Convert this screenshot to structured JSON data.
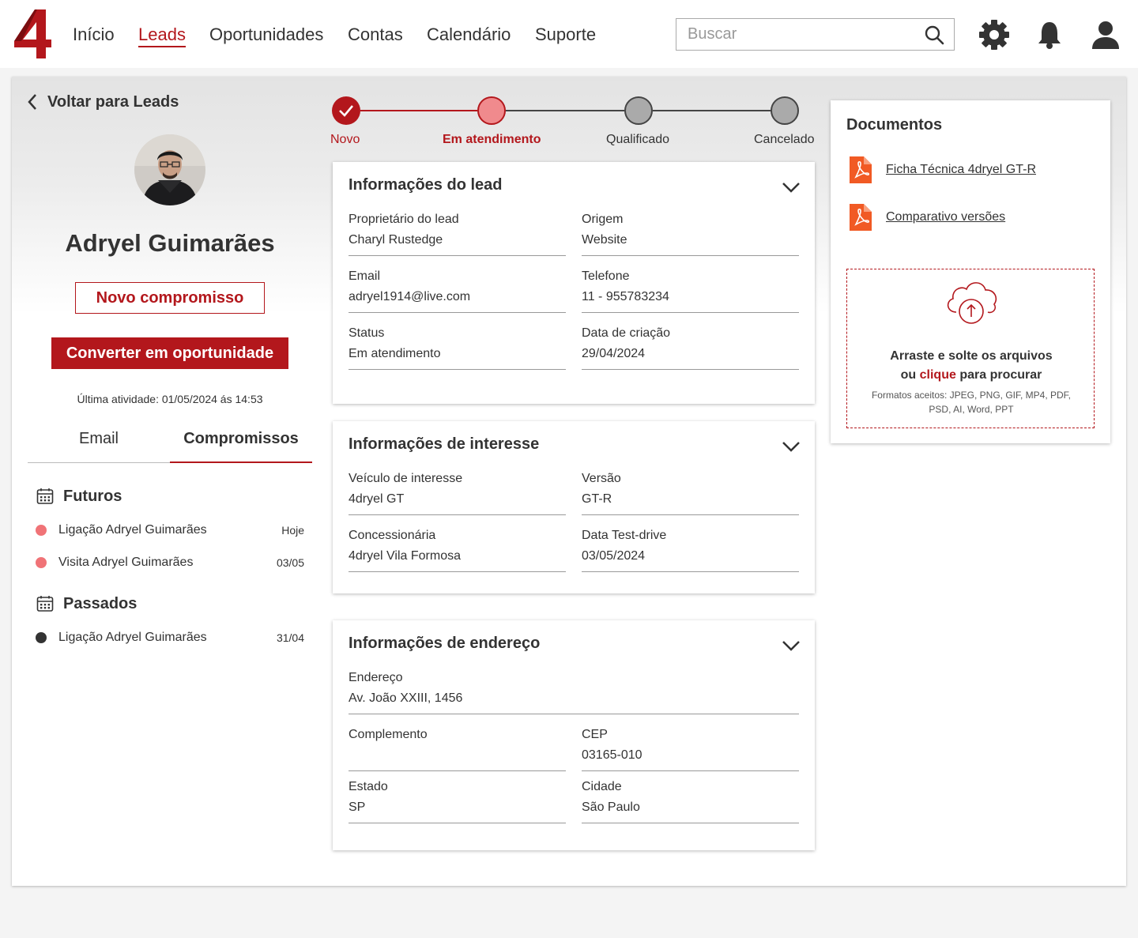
{
  "nav": {
    "links": [
      {
        "label": "Início",
        "active": false
      },
      {
        "label": "Leads",
        "active": true
      },
      {
        "label": "Oportunidades",
        "active": false
      },
      {
        "label": "Contas",
        "active": false
      },
      {
        "label": "Calendário",
        "active": false
      },
      {
        "label": "Suporte",
        "active": false
      }
    ],
    "search_placeholder": "Buscar",
    "icons": [
      "search-icon",
      "gear-icon",
      "bell-icon",
      "user-icon"
    ]
  },
  "colors": {
    "accent": "#b3171c",
    "step_current": "#f08a8d",
    "step_pending": "#aaaaaa",
    "dot_future": "#f07377",
    "dot_past": "#333333"
  },
  "back_label": "Voltar para Leads",
  "lead": {
    "name": "Adryel Guimarães",
    "new_appointment_button": "Novo compromisso",
    "convert_button": "Converter em oportunidade",
    "last_activity": "Última atividade: 01/05/2024 ás 14:53"
  },
  "tabs": [
    {
      "label": "Email",
      "active": false
    },
    {
      "label": "Compromissos",
      "active": true
    }
  ],
  "appointments": {
    "future_title": "Futuros",
    "future": [
      {
        "label": "Ligação Adryel Guimarães",
        "date": "Hoje"
      },
      {
        "label": "Visita Adryel Guimarães",
        "date": "03/05"
      }
    ],
    "past_title": "Passados",
    "past": [
      {
        "label": "Ligação Adryel Guimarães",
        "date": "31/04"
      }
    ]
  },
  "stepper": {
    "steps": [
      {
        "label": "Novo",
        "state": "done"
      },
      {
        "label": "Em atendimento",
        "state": "current"
      },
      {
        "label": "Qualificado",
        "state": "pending"
      },
      {
        "label": "Cancelado",
        "state": "pending"
      }
    ]
  },
  "cards": {
    "lead_info": {
      "title": "Informações do lead",
      "fields": [
        {
          "label": "Proprietário do lead",
          "value": "Charyl Rustedge"
        },
        {
          "label": "Origem",
          "value": "Website"
        },
        {
          "label": "Email",
          "value": "adryel1914@live.com"
        },
        {
          "label": "Telefone",
          "value": "11 - 955783234"
        },
        {
          "label": "Status",
          "value": "Em atendimento"
        },
        {
          "label": "Data de criação",
          "value": "29/04/2024"
        }
      ]
    },
    "interest_info": {
      "title": "Informações de interesse",
      "fields": [
        {
          "label": "Veículo de interesse",
          "value": "4dryel GT"
        },
        {
          "label": "Versão",
          "value": "GT-R"
        },
        {
          "label": "Concessionária",
          "value": "4dryel Vila Formosa"
        },
        {
          "label": "Data Test-drive",
          "value": "03/05/2024"
        }
      ]
    },
    "address_info": {
      "title": "Informações de endereço",
      "fields": [
        {
          "label": "Endereço",
          "value": "Av. João XXIII, 1456"
        },
        {
          "label": "Complemento",
          "value": ""
        },
        {
          "label": "CEP",
          "value": "03165-010"
        },
        {
          "label": "Estado",
          "value": "SP"
        },
        {
          "label": "Cidade",
          "value": "São Paulo"
        }
      ]
    }
  },
  "documents": {
    "title": "Documentos",
    "files": [
      {
        "label": "Ficha Técnica 4dryel GT-R",
        "icon": "pdf-icon"
      },
      {
        "label": "Comparativo versões",
        "icon": "pdf-icon"
      }
    ],
    "dropzone": {
      "line1": "Arraste e solte os arquivos",
      "line2_pre": "ou ",
      "line2_link": "clique",
      "line2_post": " para procurar",
      "formats": "Formatos aceitos: JPEG, PNG, GIF, MP4, PDF, PSD, AI, Word, PPT"
    }
  }
}
